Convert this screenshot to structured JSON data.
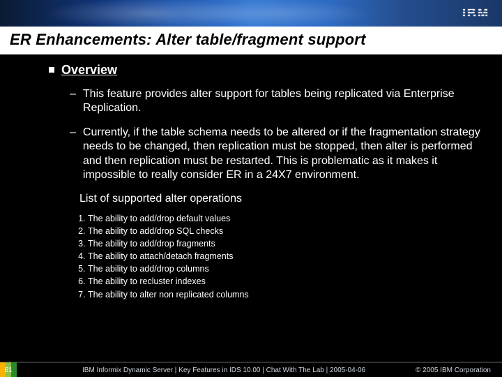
{
  "brand": {
    "logo_text": "IBM"
  },
  "title": "ER Enhancements: Alter table/fragment support",
  "overview": {
    "heading": "Overview",
    "points": [
      "This feature provides alter support for tables being replicated via Enterprise Replication.",
      "Currently, if the table schema needs to be altered or if the fragmentation strategy needs to be changed, then replication must be stopped, then alter is performed and then replication must be restarted. This is problematic as it makes it impossible to really consider ER in a 24X7 environment."
    ]
  },
  "supported_ops": {
    "heading": "List of supported alter operations",
    "items": [
      "The ability to add/drop default values",
      "The ability to add/drop SQL checks",
      "The ability to add/drop fragments",
      "The ability to attach/detach fragments",
      "The ability to add/drop columns",
      "The ability to recluster indexes",
      "The ability to alter non replicated columns"
    ]
  },
  "footer": {
    "page": "61",
    "mid": "IBM Informix Dynamic Server | Key Features in IDS 10.00 | Chat With The Lab | 2005-04-06",
    "right": "© 2005 IBM Corporation"
  }
}
